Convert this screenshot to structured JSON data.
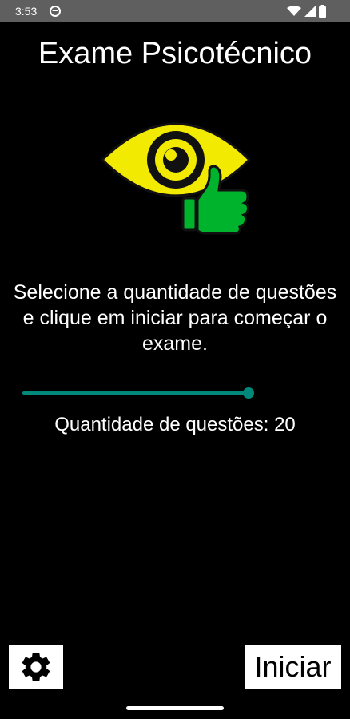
{
  "status_bar": {
    "time": "3:53",
    "icons": [
      "app-notification-icon",
      "wifi-icon",
      "signal-icon",
      "battery-icon"
    ]
  },
  "screen": {
    "title": "Exame Psicotécnico",
    "logo_icon": "eye-thumbs-up-icon",
    "instructions": "Selecione a quantidade de questões e clique em iniciar para começar o exame.",
    "slider": {
      "value_fraction": 1.0,
      "color": "#00897b"
    },
    "question_count_label": "Quantidade de questões: 20"
  },
  "bottom_bar": {
    "settings_icon": "gear-icon",
    "start_label": "Iniciar"
  },
  "colors": {
    "background": "#000000",
    "status_bar": "#5f5f5f",
    "accent": "#00897b",
    "eye_yellow": "#f2ea00",
    "thumb_green": "#00b32c"
  }
}
